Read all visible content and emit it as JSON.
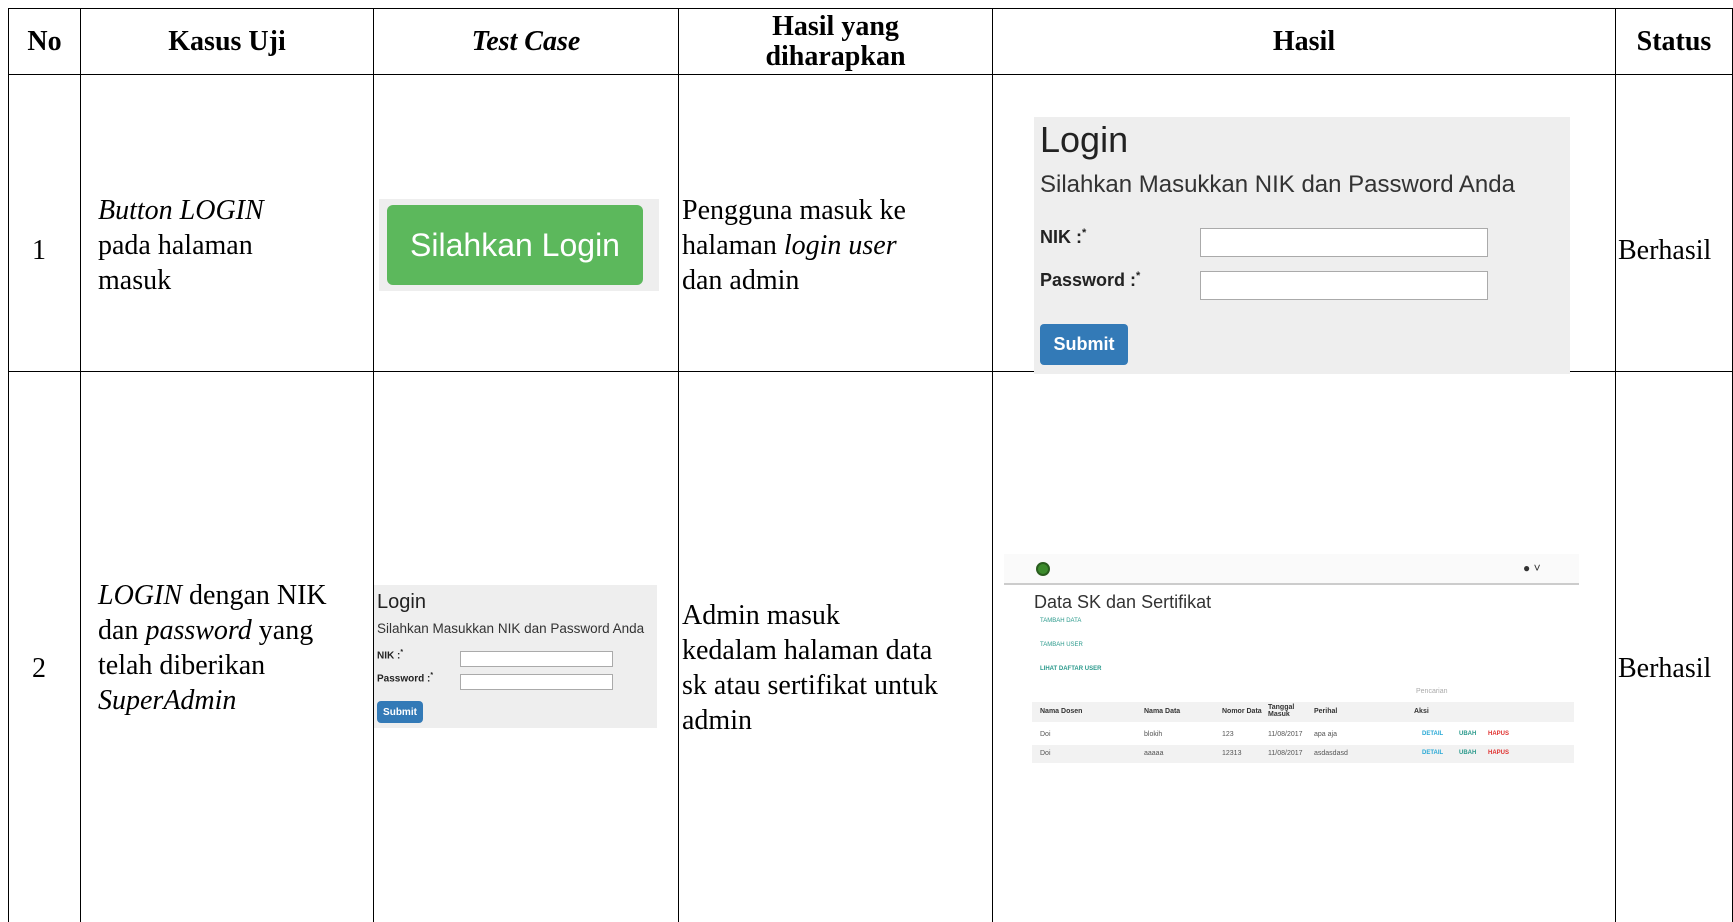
{
  "headers": {
    "no": "No",
    "kasus_uji": "Kasus Uji",
    "test_case": "Test Case",
    "hasil_diharapkan_1": "Hasil yang",
    "hasil_diharapkan_2": "diharapkan",
    "hasil": "Hasil",
    "status": "Status"
  },
  "rows": [
    {
      "no": "1",
      "kasus": {
        "l1_it": "Button LOGIN",
        "l2": "pada halaman",
        "l3": "masuk"
      },
      "test_case_button": "Silahkan Login",
      "expected": {
        "l1": "Pengguna masuk ke",
        "l2_a": "halaman ",
        "l2_it": "login user",
        "l3": "dan admin"
      },
      "status": "Berhasil"
    },
    {
      "no": "2",
      "kasus": {
        "l1_it": "LOGIN",
        "l1_rest": " dengan NIK",
        "l2_a": "dan ",
        "l2_it": "password",
        "l2_b": " yang",
        "l3": "telah diberikan",
        "l4_it": "SuperAdmin"
      },
      "expected": {
        "l1": "Admin masuk",
        "l2": "kedalam halaman data",
        "l3": "sk atau sertifikat untuk",
        "l4": "admin"
      },
      "status": "Berhasil"
    }
  ],
  "login_panel": {
    "title": "Login",
    "subtitle": "Silahkan Masukkan NIK dan Password Anda",
    "nik_label": "NIK :",
    "password_label": "Password :",
    "required_mark": "*",
    "submit": "Submit"
  },
  "admin_screen": {
    "title": "Data SK dan Sertifikat",
    "user_icon": "● ˅",
    "links": [
      "TAMBAH DATA",
      "TAMBAH USER",
      "LIHAT DAFTAR USER"
    ],
    "search_placeholder": "Pencarian",
    "columns": [
      "Nama Dosen",
      "Nama Data",
      "Nomor Data",
      "Tanggal Masuk",
      "Perihal",
      "Aksi"
    ],
    "rows": [
      [
        "Doi",
        "blokih",
        "123",
        "11/08/2017",
        "apa aja"
      ],
      [
        "Doi",
        "aaaaa",
        "12313",
        "11/08/2017",
        "asdasdasd"
      ]
    ],
    "actions": [
      "DETAIL",
      "UBAH",
      "HAPUS"
    ],
    "action_colors": [
      "#2aa9d6",
      "#2b9a8c",
      "#e0312f"
    ]
  }
}
